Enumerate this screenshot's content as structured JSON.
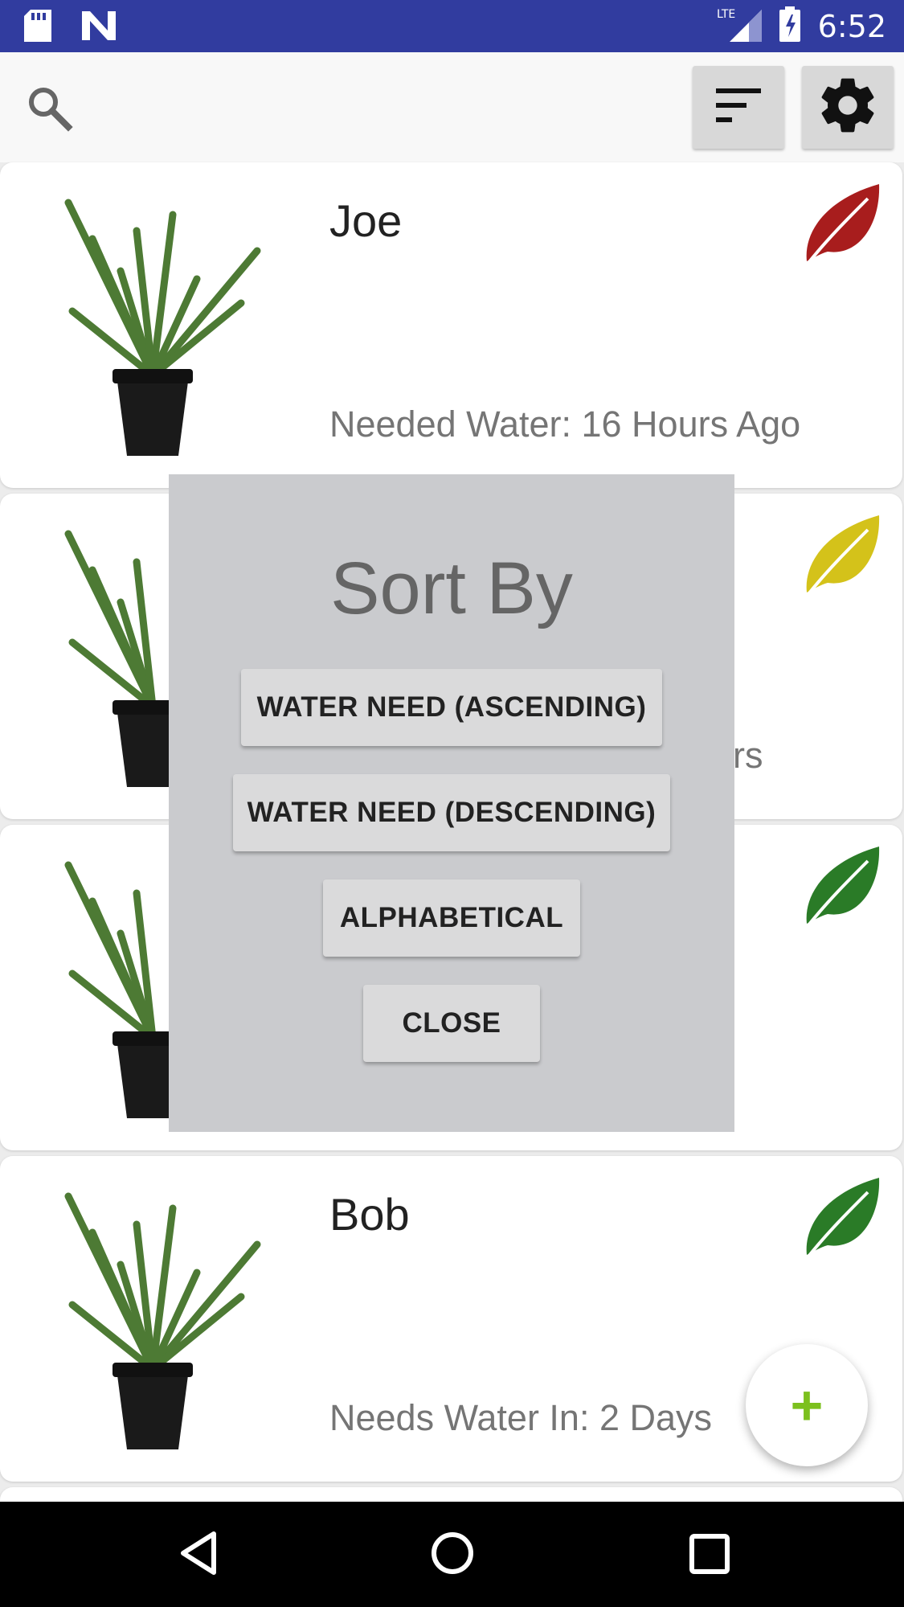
{
  "status_bar": {
    "time": "6:52",
    "network": "LTE",
    "left_icons": [
      "sd-card-icon",
      "n-notification-icon"
    ],
    "right_icons": [
      "signal-icon",
      "battery-icon"
    ]
  },
  "toolbar": {
    "search_icon": "search-icon",
    "sort_icon": "sort-icon",
    "settings_icon": "gear-icon"
  },
  "plants": [
    {
      "name": "Joe",
      "status": "Needed Water: 16 Hours Ago",
      "leaf_color": "#a81d1d"
    },
    {
      "name": "",
      "status": "",
      "status_fragment": "rs",
      "leaf_color": "#d4c21a"
    },
    {
      "name": "",
      "status": "",
      "leaf_color": "#2a7b27"
    },
    {
      "name": "Bob",
      "status": "Needs Water In: 2 Days",
      "leaf_color": "#2a7b27"
    }
  ],
  "dialog": {
    "title": "Sort By",
    "buttons": [
      "WATER NEED (ASCENDING)",
      "WATER NEED (DESCENDING)",
      "ALPHABETICAL",
      "CLOSE"
    ]
  },
  "fab": {
    "label": "+"
  },
  "nav": {
    "icons": [
      "back-icon",
      "home-icon",
      "recents-icon"
    ]
  },
  "colors": {
    "status_bar": "#313c9f",
    "fab_plus": "#7cc01e"
  }
}
